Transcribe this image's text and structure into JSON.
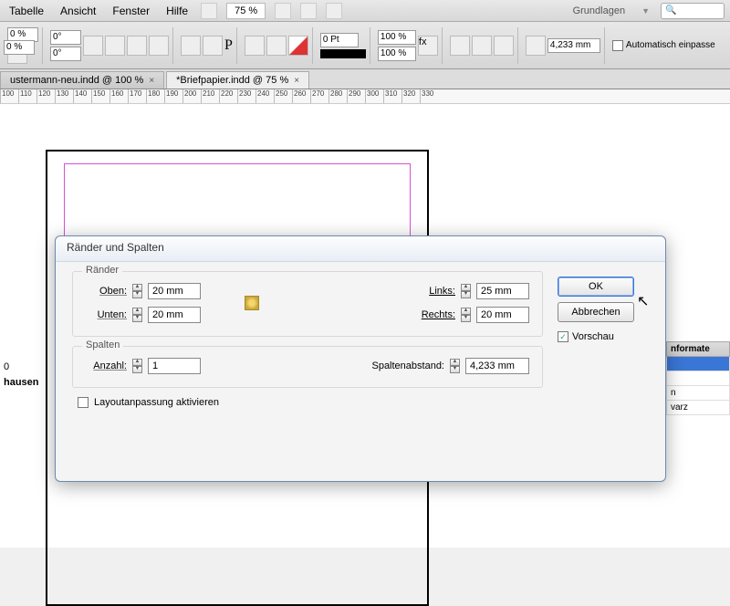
{
  "menu": {
    "tabelle": "Tabelle",
    "ansicht": "Ansicht",
    "fenster": "Fenster",
    "hilfe": "Hilfe",
    "zoom": "75 %",
    "grundlagen": "Grundlagen"
  },
  "toolbar": {
    "pct0a": "0 %",
    "deg0a": "0°",
    "deg0b": "0°",
    "pct0b": "0 %",
    "pt0": "0 Pt",
    "pct100a": "100 %",
    "pct100b": "100 %",
    "mm": "4,233 mm",
    "auto": "Automatisch einpasse"
  },
  "tabs": {
    "t1": "ustermann-neu.indd @ 100 %",
    "t2": "*Briefpapier.indd @ 75 %"
  },
  "ruler": [
    "100",
    "110",
    "120",
    "130",
    "140",
    "150",
    "160",
    "170",
    "180",
    "190",
    "200",
    "210",
    "220",
    "230",
    "240",
    "250",
    "260",
    "270",
    "280",
    "290",
    "300",
    "310",
    "320",
    "330"
  ],
  "sidetext": {
    "l1": "0",
    "l2": "hausen"
  },
  "panel": {
    "hdr": "nformate",
    "r2": "n",
    "r3": "varz"
  },
  "dialog": {
    "title": "Ränder und Spalten",
    "group_margins": "Ränder",
    "group_columns": "Spalten",
    "oben": "Oben:",
    "unten": "Unten:",
    "links": "Links:",
    "rechts": "Rechts:",
    "anzahl": "Anzahl:",
    "spaltenabstand": "Spaltenabstand:",
    "v_oben": "20 mm",
    "v_unten": "20 mm",
    "v_links": "25 mm",
    "v_rechts": "20 mm",
    "v_anzahl": "1",
    "v_abstand": "4,233 mm",
    "ok": "OK",
    "abbrechen": "Abbrechen",
    "vorschau": "Vorschau",
    "layoutanp": "Layoutanpassung aktivieren"
  }
}
